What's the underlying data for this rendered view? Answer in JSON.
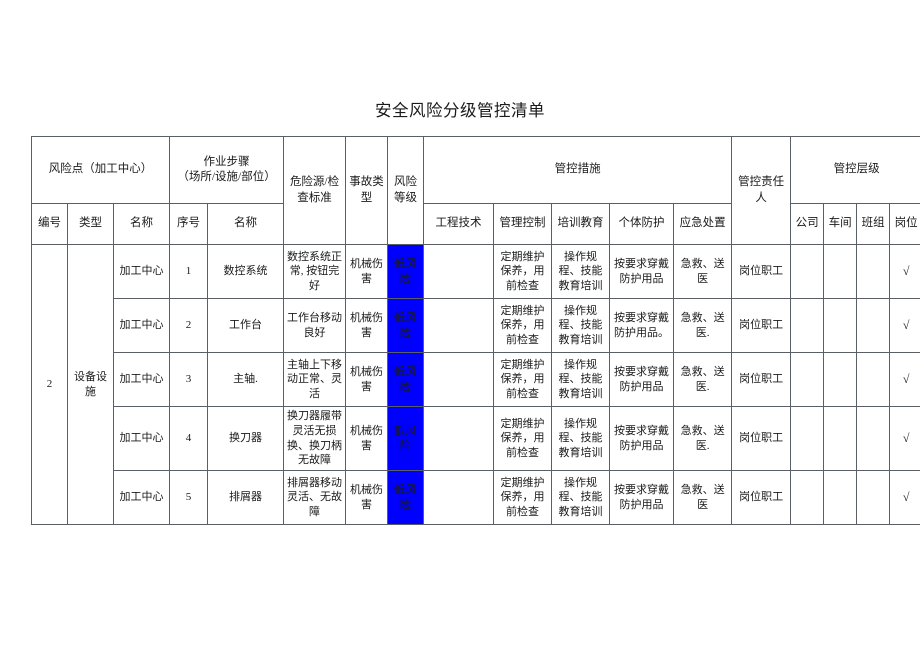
{
  "document": {
    "title": "安全风险分级管控清单"
  },
  "table": {
    "header": {
      "risk_point_group": "风险点（加工中心）",
      "work_step_group_line1": "作业步骤",
      "work_step_group_line2": "（场所/设施/部位）",
      "hazard_source": "危险源/检查标准",
      "accident_type": "事故类型",
      "risk_level": "风险等级",
      "control_measures_group": "管控措施",
      "responsible_person": "管控责任人",
      "control_level_group": "管控层级",
      "sub": {
        "risk_point_no": "编号",
        "risk_point_type": "类型",
        "risk_point_name": "名称",
        "step_no": "序号",
        "step_name": "名称",
        "engineering_tech": "工程技术",
        "management_control": "管理控制",
        "training_education": "培训教育",
        "personal_protection": "个体防护",
        "emergency_response": "应急处置",
        "level_company": "公司",
        "level_workshop": "车间",
        "level_team": "班组",
        "level_post": "岗位"
      }
    },
    "merged": {
      "risk_point_no": "2",
      "risk_point_type": "设备设施"
    },
    "rows": [
      {
        "risk_point_name": "加工中心",
        "step_no": "1",
        "step_name": "数控系统",
        "hazard_source": "数控系统正常, 按钮完好",
        "accident_type": "机械伤害",
        "risk_level": "低风险",
        "engineering_tech": "",
        "management_control": "定期维护保养，用前检查",
        "training_education": "操作规程、技能教育培训",
        "personal_protection": "按要求穿戴防护用品",
        "emergency_response": "急救、送医",
        "responsible_person": "岗位职工",
        "level_company": "",
        "level_workshop": "",
        "level_team": "",
        "level_post": "√"
      },
      {
        "risk_point_name": "加工中心",
        "step_no": "2",
        "step_name": "工作台",
        "hazard_source": "工作台移动良好",
        "accident_type": "机械伤害",
        "risk_level": "低风险",
        "engineering_tech": "",
        "management_control": "定期维护保养，用前检查",
        "training_education": "操作规程、技能教育培训",
        "personal_protection": "按要求穿戴防护用品。",
        "emergency_response": "急救、送医.",
        "responsible_person": "岗位职工",
        "level_company": "",
        "level_workshop": "",
        "level_team": "",
        "level_post": "√"
      },
      {
        "risk_point_name": "加工中心",
        "step_no": "3",
        "step_name": "主轴.",
        "hazard_source": "主轴上下移动正常、灵活",
        "accident_type": "机械伤害",
        "risk_level": "低风险",
        "engineering_tech": "",
        "management_control": "定期维护保养，用前检查",
        "training_education": "操作规程、技能教育培训",
        "personal_protection": "按要求穿戴防护用品",
        "emergency_response": "急救、送医.",
        "responsible_person": "岗位职工",
        "level_company": "",
        "level_workshop": "",
        "level_team": "",
        "level_post": "√"
      },
      {
        "risk_point_name": "加工中心",
        "step_no": "4",
        "step_name": "换刀器",
        "hazard_source": "换刀器履带灵活无损换、换刀柄无故障",
        "accident_type": "机械伤害",
        "risk_level": "低风险",
        "engineering_tech": "",
        "management_control": "定期维护保养，用前检查",
        "training_education": "操作规程、技能教育培训",
        "personal_protection": "按要求穿戴防护用品",
        "emergency_response": "急救、送医.",
        "responsible_person": "岗位职工",
        "level_company": "",
        "level_workshop": "",
        "level_team": "",
        "level_post": "√"
      },
      {
        "risk_point_name": "加工中心",
        "step_no": "5",
        "step_name": "排屑器",
        "hazard_source": "排屑器移动灵活、无故障",
        "accident_type": "机械伤害",
        "risk_level": "低风险",
        "engineering_tech": "",
        "management_control": "定期维护保养，用前检查",
        "training_education": "操作规程、技能教育培训",
        "personal_protection": "按要求穿戴防护用品",
        "emergency_response": "急救、送医",
        "responsible_person": "岗位职工",
        "level_company": "",
        "level_workshop": "",
        "level_team": "",
        "level_post": "√"
      }
    ]
  },
  "colors": {
    "risk_level_background": "#0000ff",
    "risk_level_text": "#3a3ad0",
    "border": "#5a5f66",
    "text": "#1a1a1a"
  }
}
